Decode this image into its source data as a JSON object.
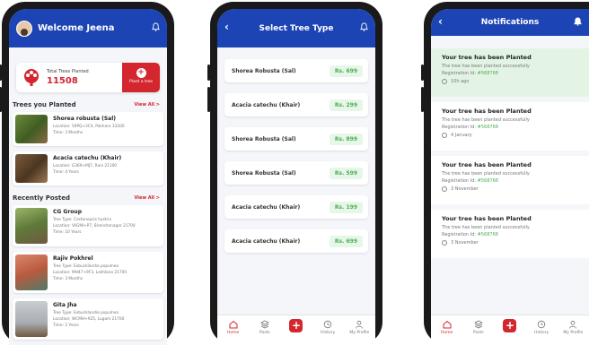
{
  "screen1": {
    "welcome": "Welcome Jeena",
    "total_label": "Total Trees Planted",
    "total_value": "11508",
    "plant_button": "Plant a tree",
    "planted_section": "Trees you Planted",
    "view_all": "View All >",
    "planted": [
      {
        "name": "Shorea robusta (Sal)",
        "location": "Location: 59PQ+3C4, Pokhara 33200",
        "time": "Time: 3 Months"
      },
      {
        "name": "Acacia catechu (Khair)",
        "location": "Location: G369+MJ7, Rani 21100",
        "time": "Time: 4 Years"
      }
    ],
    "recent_section": "Recently Posted",
    "recent": [
      {
        "name": "CG Group",
        "type": "Tree Type: Castanopsis hystrix",
        "location": "Location: VH2W+P7, Birendranagar 21700",
        "time": "Time: 10 Years"
      },
      {
        "name": "Rajiv Pokhrel",
        "type": "Tree Type: Exbucklandia populnea",
        "location": "Location: MH47+9F3, Lekhlana 21700",
        "time": "Time: 3 Months"
      },
      {
        "name": "Gita Jha",
        "type": "Tree Type: Exbucklandia populnea",
        "location": "Location: WCMH+925, Lugam 21700",
        "time": "Time: 2 Years"
      }
    ]
  },
  "screen2": {
    "title": "Select Tree Type",
    "trees": [
      {
        "name": "Shorea Robusta (Sal)",
        "price": "Rs. 699"
      },
      {
        "name": "Acacia catechu (Khair)",
        "price": "Rs. 299"
      },
      {
        "name": "Shorea Robusta (Sal)",
        "price": "Rs. 899"
      },
      {
        "name": "Shorea Robusta (Sal)",
        "price": "Rs. 599"
      },
      {
        "name": "Acacia catechu (Khair)",
        "price": "Rs. 199"
      },
      {
        "name": "Acacia catechu (Khair)",
        "price": "Rs. 699"
      }
    ]
  },
  "screen3": {
    "title": "Notifications",
    "notifications": [
      {
        "title": "Your tree has been Planted",
        "desc": "The tree has been planted successfully",
        "reg_label": "Registration Id: ",
        "reg_id": "#568768",
        "time": "10h ago",
        "highlight": true
      },
      {
        "title": "Your tree has been Planted",
        "desc": "The tree has been planted successfully",
        "reg_label": "Registration Id: ",
        "reg_id": "#568768",
        "time": "4 January",
        "highlight": false
      },
      {
        "title": "Your tree has been Planted",
        "desc": "The tree has been planted successfully",
        "reg_label": "Registration Id: ",
        "reg_id": "#568768",
        "time": "3 November",
        "highlight": false
      },
      {
        "title": "Your tree has been Planted",
        "desc": "The tree has been planted successfully",
        "reg_label": "Registration Id: ",
        "reg_id": "#568768",
        "time": "3 November",
        "highlight": false
      }
    ]
  },
  "nav": {
    "home": "Home",
    "posts": "Posts",
    "history": "History",
    "profile": "My Profile"
  },
  "colors": {
    "primary": "#1c44b4",
    "accent": "#d3262e",
    "price_green": "#4caf50"
  }
}
